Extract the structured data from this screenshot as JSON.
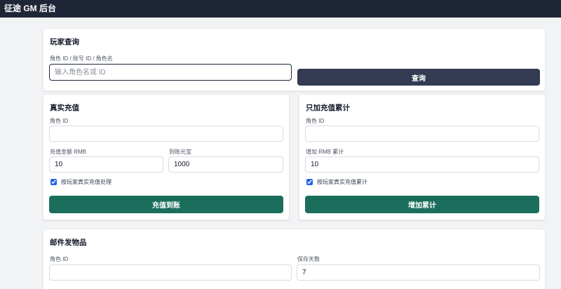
{
  "app": {
    "title": "征途 GM 后台"
  },
  "player_query": {
    "title": "玩家查询",
    "field_label": "角色 ID / 账号 ID / 角色名",
    "placeholder": "输入角色名或 ID",
    "value": "",
    "button": "查询"
  },
  "real_recharge": {
    "title": "真实充值",
    "role_id_label": "角色 ID",
    "role_id_value": "",
    "amount_label": "充值金额 RMB",
    "amount_value": "10",
    "yuanbao_label": "到账元宝",
    "yuanbao_value": "1000",
    "checkbox_label": "按玩家真实充值处理",
    "checkbox_checked": true,
    "button": "充值到账"
  },
  "add_total": {
    "title": "只加充值累计",
    "role_id_label": "角色 ID",
    "role_id_value": "",
    "amount_label": "增加 RMB 累计",
    "amount_value": "10",
    "checkbox_label": "按玩家真实充值累计",
    "checkbox_checked": true,
    "button": "增加累计"
  },
  "mail": {
    "title": "邮件发物品",
    "role_id_label": "角色 ID",
    "role_id_value": "",
    "days_label": "保存天数",
    "days_value": "7"
  },
  "colors": {
    "topbar": "#1f2638",
    "query_button": "#323b52",
    "action_button": "#1b6e5c",
    "page_background": "#f2f3f5"
  }
}
